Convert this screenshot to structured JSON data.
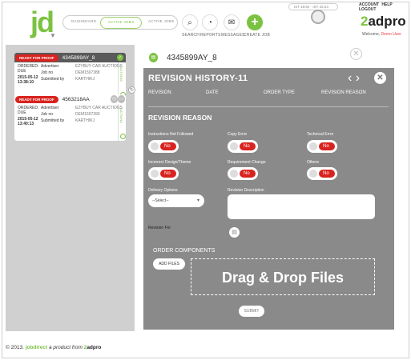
{
  "header": {
    "logo": "jd",
    "nav": {
      "dashboard": "DASHBOARD",
      "active": "ACTIVE JOBS",
      "archive": "ACTIVE JOBS"
    },
    "tools": [
      {
        "label": "SEARCH",
        "icon": "search-icon",
        "glyph": "⌕"
      },
      {
        "label": "REPORTS",
        "icon": "reports-icon",
        "glyph": "◔"
      },
      {
        "label": "MESSAGES",
        "icon": "messages-icon",
        "glyph": "✉"
      },
      {
        "label": "CREATE JOB",
        "icon": "add-icon",
        "glyph": "+"
      }
    ],
    "clock_text": "IST 18:54 · IST 22:24",
    "top_links": "ACCOUNT  HELP  LOGOUT",
    "brand_num": "2",
    "brand_word": "adpro",
    "welcome": "Welcome,",
    "user": "Demo User"
  },
  "jobs": [
    {
      "badge": "READY FOR PROOF",
      "id": "4345899AY_8",
      "ordered": "ORDERED:",
      "due": "DUE",
      "date": "2015-05-12",
      "time": "13:38:10",
      "advertiser_label": "Advertiser",
      "advertiser": "EZYBUY CAR AUCTIONS",
      "jobno_label": "Job no",
      "jobno": "DEM1597388",
      "submitted_label": "Submitted by",
      "submitted": "KARTHIKJ",
      "side": "ACTIONS"
    },
    {
      "badge": "READY FOR PROOF",
      "id": "4563218AA",
      "ordered": "ORDERED:",
      "due": "DUE",
      "date": "2015-05-12",
      "time": "13:40:13",
      "advertiser_label": "Advertiser",
      "advertiser": "EZYBUY CAR AUCTIONS",
      "jobno_label": "Job no",
      "jobno": "DEM1597390",
      "submitted_label": "Submitted by",
      "submitted": "KARTHIKJ",
      "side": "ACTIONS"
    }
  ],
  "order": {
    "id": "4345899AY_8"
  },
  "modal": {
    "title": "REVISION HISTORY-11",
    "columns": [
      "REVISION",
      "DATE",
      "ORDER TYPE",
      "REVISION REASON"
    ],
    "reason_title": "REVISION REASON",
    "fields": [
      {
        "label": "Instructions Not Followed",
        "value": "No"
      },
      {
        "label": "Copy Error",
        "value": "No"
      },
      {
        "label": "Technical Error",
        "value": "No"
      },
      {
        "label": "Incorrect Design/Theme",
        "value": "No"
      },
      {
        "label": "Requirement Change",
        "value": "No"
      },
      {
        "label": "Others",
        "value": "No"
      }
    ],
    "delivery_label": "Delivery Options",
    "delivery_value": "--Select--",
    "description_label": "Revision Description",
    "revision_for": "Revision For",
    "components": "ORDER COMPONENTS",
    "add_files": "ADD FILES",
    "drop": "Drag & Drop Files",
    "submit": "SUBMIT"
  },
  "footer": {
    "copy": "© 2013.",
    "jd": "jobdirect",
    "mid": "a product from",
    "brand_num": "2",
    "brand_word": "adpro"
  }
}
